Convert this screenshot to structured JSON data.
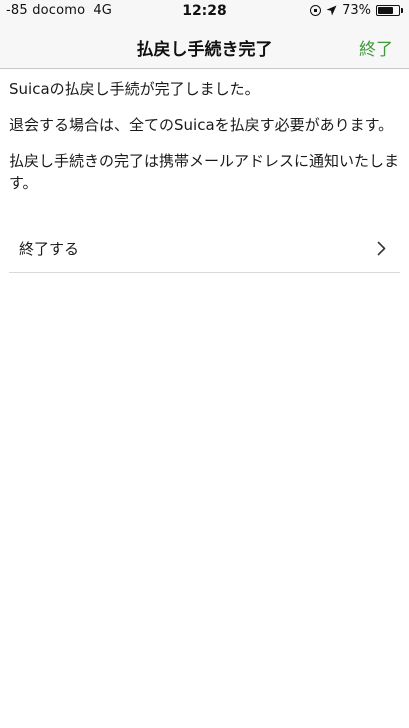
{
  "status_bar": {
    "signal": "-85",
    "carrier": "docomo",
    "network": "4G",
    "time": "12:28",
    "battery_percent_label": "73%",
    "battery_level": 0.73
  },
  "nav": {
    "title": "払戻し手続き完了",
    "done_label": "終了",
    "accent_color": "#3f9b3a"
  },
  "content": {
    "paragraphs": [
      "Suicaの払戻し手続が完了しました。",
      "退会する場合は、全てのSuicaを払戻す必要があります。",
      "払戻し手続きの完了は携帯メールアドレスに通知いたします。"
    ]
  },
  "list": {
    "items": [
      {
        "label": "終了する",
        "icon": "chevron-right-icon"
      }
    ]
  }
}
